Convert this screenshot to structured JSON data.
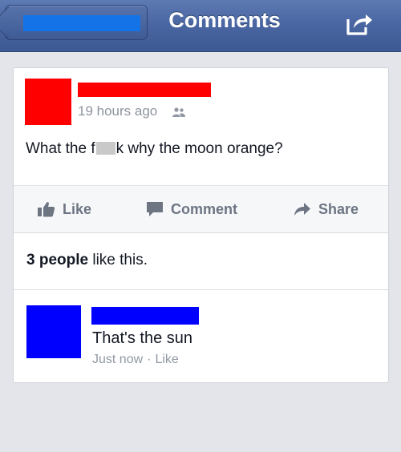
{
  "navbar": {
    "title": "Comments",
    "back_icon": "back-arrow",
    "share_icon": "share-out-icon"
  },
  "post": {
    "timestamp": "19 hours ago",
    "audience_icon": "friends-icon",
    "text_before": "What the f",
    "text_after": "k why the moon orange?",
    "redaction_color": "#ff0000"
  },
  "actions": {
    "like": "Like",
    "comment": "Comment",
    "share": "Share"
  },
  "likes": {
    "count_text": "3 people",
    "suffix": " like this."
  },
  "comment": {
    "text": "That's the sun",
    "time": "Just now",
    "separator": "·",
    "like": "Like",
    "redaction_color": "#0000ff"
  },
  "colors": {
    "nav_blue": "#4a67a3",
    "back_redaction": "#1473e6",
    "action_gray": "#6d7583"
  }
}
